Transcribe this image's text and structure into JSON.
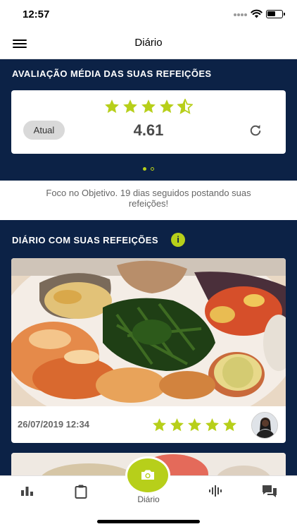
{
  "status_bar": {
    "time": "12:57",
    "battery_level": 0.6
  },
  "nav": {
    "title": "Diário",
    "menu_icon": "hamburger-menu-icon"
  },
  "rating": {
    "section_title": "AVALIAÇÃO MÉDIA DAS SUAS REFEIÇÕES",
    "stars_value": 4.5,
    "stars_max": 5,
    "period_label": "Atual",
    "average": "4.61",
    "refresh_icon": "refresh-icon",
    "pager": {
      "pages": 2,
      "active": 0
    }
  },
  "streak_message": "Foco no Objetivo. 19 dias seguidos postando suas refeições!",
  "diary": {
    "section_title": "DIÁRIO COM SUAS REFEIÇÕES",
    "info_icon": "info-icon",
    "info_glyph": "i",
    "meals": [
      {
        "datetime": "26/07/2019 12:34",
        "rating": 5,
        "rating_max": 5
      }
    ]
  },
  "tab_bar": {
    "items": [
      {
        "icon": "bar-chart-icon"
      },
      {
        "icon": "clipboard-icon"
      },
      {
        "icon": "camera-icon",
        "label": "Diário"
      },
      {
        "icon": "audio-wave-icon"
      },
      {
        "icon": "chat-bubbles-icon"
      }
    ]
  },
  "colors": {
    "navy": "#0c2246",
    "accent": "#b7cf1a",
    "white": "#ffffff"
  }
}
